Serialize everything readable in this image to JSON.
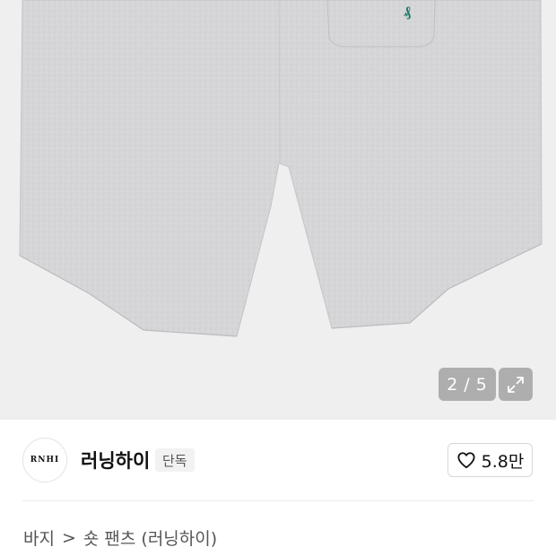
{
  "gallery": {
    "current": "2",
    "separator": "/",
    "total": "5",
    "background": "#efefef",
    "fabric_color": "#d5d5d7",
    "logo_color": "#1f7a6b"
  },
  "brand": {
    "logo_text": "RNHI",
    "name": "러닝하이",
    "badge": "단독"
  },
  "like": {
    "count": "5.8만"
  },
  "breadcrumb": {
    "items": [
      "바지",
      "숏 팬츠 (러닝하이)"
    ],
    "separator": ">"
  }
}
